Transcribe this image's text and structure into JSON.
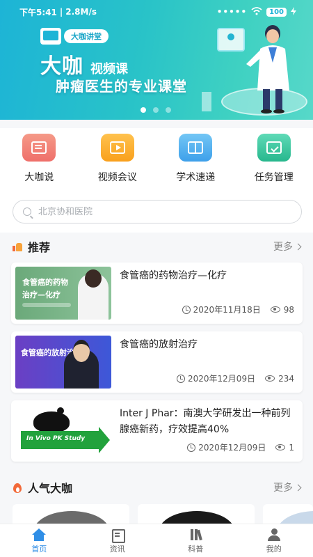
{
  "status_bar": {
    "time": "下午5:41",
    "speed": "2.8M/s",
    "signal": "•••••",
    "battery": "100"
  },
  "banner": {
    "tag": "大咖讲堂",
    "title_big": "大咖",
    "title_small": "视频课",
    "subtitle": "肿瘤医生的专业课堂",
    "pages": 3,
    "active_page": 1
  },
  "quick_menu": [
    {
      "label": "大咖说",
      "icon": "chat-doc-icon"
    },
    {
      "label": "视频会议",
      "icon": "video-play-icon"
    },
    {
      "label": "学术速递",
      "icon": "book-icon"
    },
    {
      "label": "任务管理",
      "icon": "clipboard-check-icon"
    }
  ],
  "search": {
    "placeholder": "北京协和医院"
  },
  "recommend": {
    "title": "推荐",
    "more": "更多"
  },
  "articles": [
    {
      "title": "食管癌的药物治疗—化疗",
      "thumb_text": "食管癌的药物\n治疗—化疗",
      "date": "2020年11月18日",
      "views": "98"
    },
    {
      "title": "食管癌的放射治疗",
      "thumb_text": "食管癌的放射治疗",
      "date": "2020年12月09日",
      "views": "234"
    },
    {
      "title": "Inter J Phar：南澳大学研发出一种前列腺癌新药，疗效提高40%",
      "thumb_text": "In Vivo PK Study",
      "date": "2020年12月09日",
      "views": "1"
    }
  ],
  "popular": {
    "title": "人气大咖",
    "more": "更多"
  },
  "tabbar": [
    {
      "label": "首页",
      "active": true
    },
    {
      "label": "资讯",
      "active": false
    },
    {
      "label": "科普",
      "active": false
    },
    {
      "label": "我的",
      "active": false
    }
  ],
  "colors": {
    "banner_start": "#1db4d6",
    "banner_end": "#57d8c9",
    "accent_blue": "#2f8ee6",
    "hot_orange": "#f26a3a"
  }
}
